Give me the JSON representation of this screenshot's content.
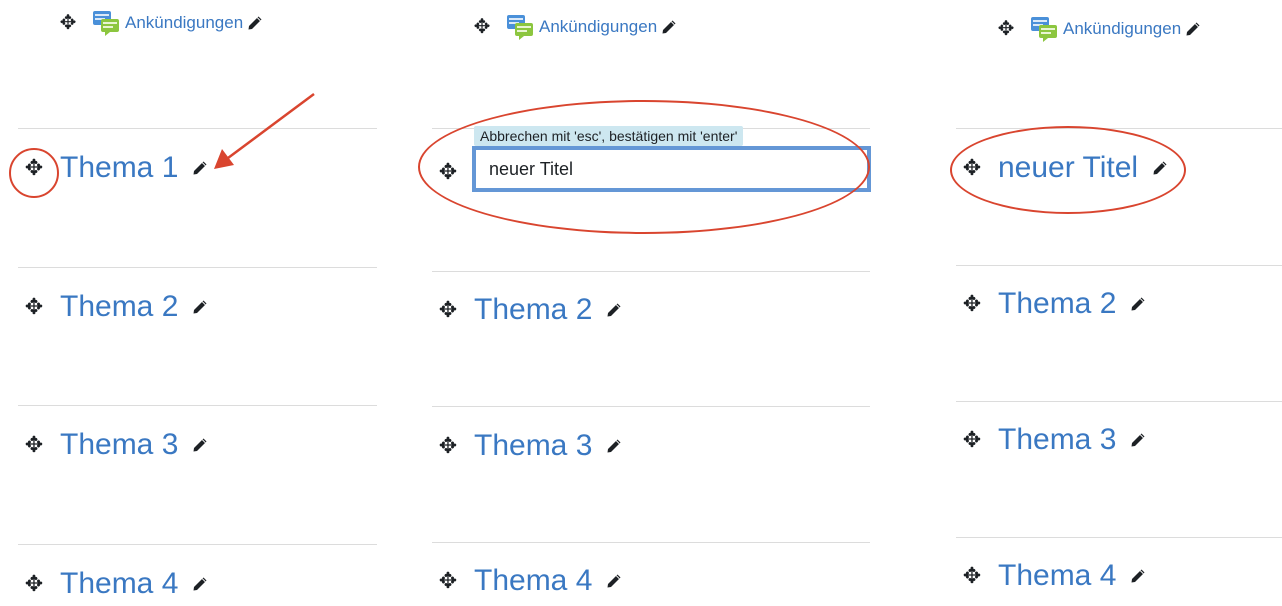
{
  "colors": {
    "link": "#3a78c2",
    "annotation": "#d9452f",
    "focus_border": "#6497d6",
    "tooltip_bg": "#cde7f0"
  },
  "icons": {
    "move": "move-arrows-icon",
    "edit": "pencil-icon",
    "forum": "forum-chat-icon"
  },
  "announcements": {
    "title": "Ankündigungen"
  },
  "step1": {
    "sections": [
      "Thema 1",
      "Thema 2",
      "Thema 3",
      "Thema 4"
    ]
  },
  "step2": {
    "tooltip": "Abbrechen mit 'esc', bestätigen mit 'enter'",
    "input_value": "neuer Titel",
    "sections": [
      "Thema 2",
      "Thema 3",
      "Thema 4"
    ]
  },
  "step3": {
    "sections": [
      "neuer Titel",
      "Thema 2",
      "Thema 3",
      "Thema 4"
    ]
  }
}
